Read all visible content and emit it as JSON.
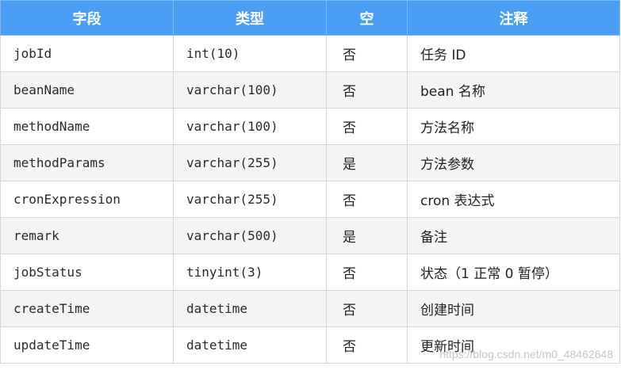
{
  "headers": {
    "field": "字段",
    "type": "类型",
    "nullable": "空",
    "comment": "注释"
  },
  "rows": [
    {
      "field": "jobId",
      "type": "int(10)",
      "nullable": "否",
      "comment": "任务 ID"
    },
    {
      "field": "beanName",
      "type": "varchar(100)",
      "nullable": "否",
      "comment": "bean 名称"
    },
    {
      "field": "methodName",
      "type": "varchar(100)",
      "nullable": "否",
      "comment": "方法名称"
    },
    {
      "field": "methodParams",
      "type": "varchar(255)",
      "nullable": "是",
      "comment": "方法参数"
    },
    {
      "field": "cronExpression",
      "type": "varchar(255)",
      "nullable": "否",
      "comment": "cron 表达式"
    },
    {
      "field": "remark",
      "type": "varchar(500)",
      "nullable": "是",
      "comment": "备注"
    },
    {
      "field": "jobStatus",
      "type": "tinyint(3)",
      "nullable": "否",
      "comment": "状态（1 正常 0 暂停）"
    },
    {
      "field": "createTime",
      "type": "datetime",
      "nullable": "否",
      "comment": "创建时间"
    },
    {
      "field": "updateTime",
      "type": "datetime",
      "nullable": "否",
      "comment": "更新时间"
    }
  ],
  "watermark": "https://blog.csdn.net/m0_48462648",
  "colors": {
    "header_bg": "#4a9ff5",
    "header_text": "#ffffff",
    "row_alt_bg": "#f4f4f4",
    "border": "#d7d7d7"
  }
}
